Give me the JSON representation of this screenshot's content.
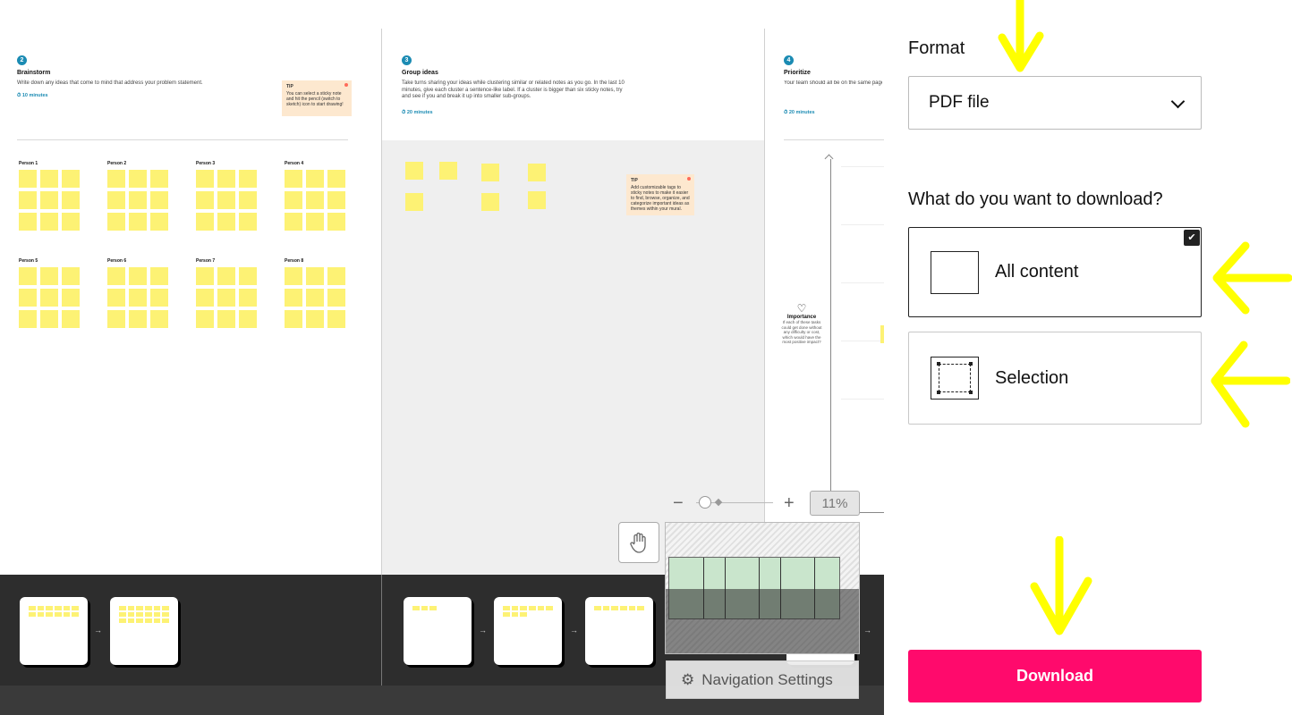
{
  "canvas": {
    "frames": [
      {
        "num": "2",
        "title": "Brainstorm",
        "desc": "Write down any ideas that come to mind that address your problem statement.",
        "time": "10 minutes",
        "tip": {
          "title": "TIP",
          "text": "You can select a sticky note and hit the pencil (switch to sketch) icon to start drawing!"
        },
        "persons": [
          "Person 1",
          "Person 2",
          "Person 3",
          "Person 4",
          "Person 5",
          "Person 6",
          "Person 7",
          "Person 8"
        ]
      },
      {
        "num": "3",
        "title": "Group ideas",
        "desc": "Take turns sharing your ideas while clustering similar or related notes as you go. In the last 10 minutes, give each cluster a sentence-like label. If a cluster is bigger than six sticky notes, try and see if you and break it up into smaller sub-groups.",
        "time": "20 minutes",
        "tip": {
          "title": "TIP",
          "text": "Add customizable tags to sticky notes to make it easier to find, browse, organize, and categorize important ideas as themes within your mural."
        }
      },
      {
        "num": "4",
        "title": "Prioritize",
        "desc": "Your team should all be on the same page about what's important moving forward. Place your ideas on this grid to determine which ideas are important and which are feasible.",
        "time": "20 minutes",
        "axis": {
          "label": "Importance",
          "desc": "If each of these tasks could get done without any difficulty or cost, which would have the most positive impact?"
        }
      }
    ]
  },
  "zoom": {
    "value": "11%",
    "minus": "−",
    "plus": "+"
  },
  "navigation_settings": {
    "label": "Navigation Settings"
  },
  "panel": {
    "format_label": "Format",
    "format_value": "PDF file",
    "download_question": "What do you want to download?",
    "options": [
      {
        "label": "All content",
        "selected": true
      },
      {
        "label": "Selection",
        "selected": false
      }
    ],
    "download_button": "Download"
  },
  "colors": {
    "accent": "#ff0a6c",
    "sticky": "#fdf274",
    "annotation": "#ffff00",
    "step": "#1b8bb3"
  }
}
